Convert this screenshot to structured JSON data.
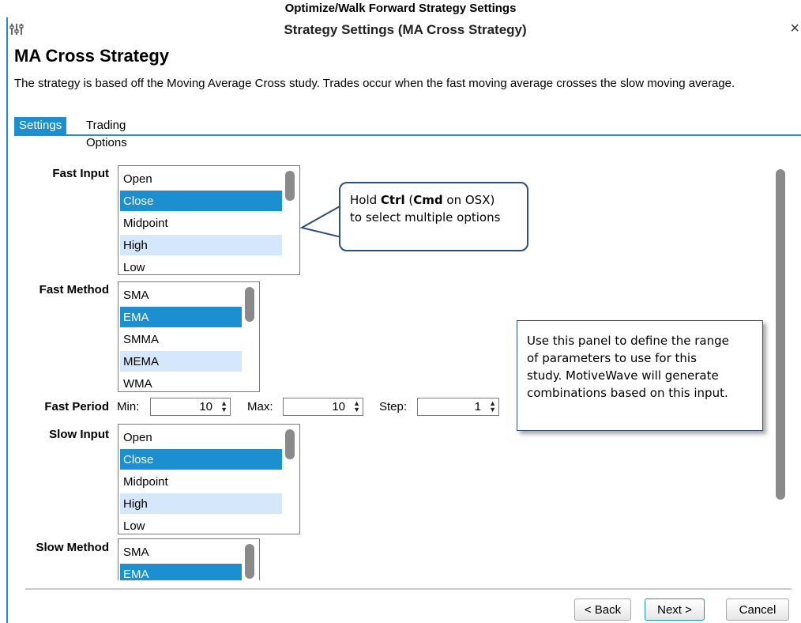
{
  "caption": "Optimize/Walk Forward Strategy Settings",
  "window": {
    "title": "Strategy Settings (MA Cross Strategy)",
    "close": "×"
  },
  "heading": "MA Cross Strategy",
  "description": "The strategy is based off the Moving Average Cross study.  Trades occur when the fast moving average crosses the slow moving average.",
  "tabs": [
    {
      "label": "Settings",
      "active": true
    },
    {
      "label": "Trading Options",
      "active": false
    }
  ],
  "fast_input": {
    "label": "Fast Input",
    "options": [
      "Open",
      "Close",
      "Midpoint",
      "High",
      "Low"
    ],
    "selected": "Close"
  },
  "fast_method": {
    "label": "Fast Method",
    "options": [
      "SMA",
      "EMA",
      "SMMA",
      "MEMA",
      "WMA"
    ],
    "selected": "EMA"
  },
  "fast_period": {
    "label": "Fast Period",
    "min_label": "Min:",
    "min_value": "10",
    "max_label": "Max:",
    "max_value": "10",
    "step_label": "Step:",
    "step_value": "1"
  },
  "slow_input": {
    "label": "Slow Input",
    "options": [
      "Open",
      "Close",
      "Midpoint",
      "High",
      "Low"
    ],
    "selected": "Close"
  },
  "slow_method": {
    "label": "Slow Method",
    "options": [
      "SMA",
      "EMA"
    ],
    "selected": "EMA"
  },
  "callout": {
    "part1": "Hold ",
    "ctrl": "Ctrl",
    "part2": " (",
    "cmd": "Cmd",
    "part3": " on OSX)",
    "line2": "to select multiple options"
  },
  "note": {
    "lines": [
      "Use this panel to define the range",
      "of parameters to use for this",
      "study.  MotiveWave will generate",
      "combinations based on this input."
    ]
  },
  "buttons": {
    "back": "< Back",
    "next": "Next >",
    "cancel": "Cancel"
  },
  "colors": {
    "accent": "#1c8fd0",
    "highlight": "#d5e8fb"
  },
  "icons": {
    "settings": "sliders-icon",
    "close": "close-icon"
  }
}
